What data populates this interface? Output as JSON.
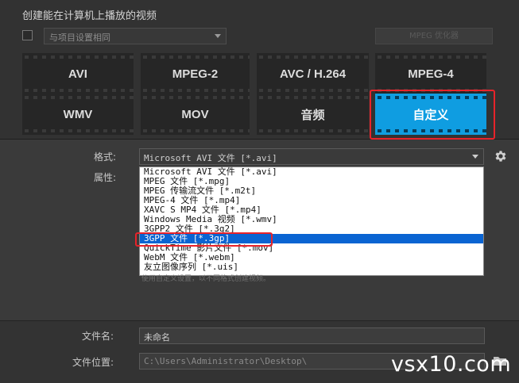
{
  "header": {
    "title": "创建能在计算机上播放的视频",
    "preset_label": "与项目设置相同",
    "settings_button_label": "MPEG 优化器"
  },
  "format_tiles": [
    {
      "label": "AVI"
    },
    {
      "label": "MPEG-2"
    },
    {
      "label": "AVC / H.264"
    },
    {
      "label": "MPEG-4"
    },
    {
      "label": "WMV"
    },
    {
      "label": "MOV"
    },
    {
      "label": "音频"
    },
    {
      "label": "自定义",
      "active": true
    }
  ],
  "format": {
    "label": "格式:",
    "value": "Microsoft AVI 文件 [*.avi]",
    "options": [
      "Microsoft AVI 文件 [*.avi]",
      "MPEG 文件 [*.mpg]",
      "MPEG 传输流文件 [*.m2t]",
      "MPEG-4 文件 [*.mp4]",
      "XAVC S MP4 文件 [*.mp4]",
      "Windows Media 视频 [*.wmv]",
      "3GPP2 文件 [*.3g2]",
      "3GPP 文件 [*.3gp]",
      "QuickTime 影片文件 [*.mov]",
      "WebM 文件 [*.webm]",
      "友立图像序列 [*.uis]"
    ],
    "selected_index": 7
  },
  "properties": {
    "label": "属性:",
    "hint": "使用自定义设置，以不同格式创建视频。"
  },
  "filename": {
    "label": "文件名:",
    "value": "未命名"
  },
  "location": {
    "label": "文件位置:",
    "value": "C:\\Users\\Administrator\\Desktop\\"
  },
  "watermark": "vsx10.com",
  "colors": {
    "accent": "#0f9de1",
    "highlight_red": "#e8232a",
    "selection": "#0a64d2"
  }
}
